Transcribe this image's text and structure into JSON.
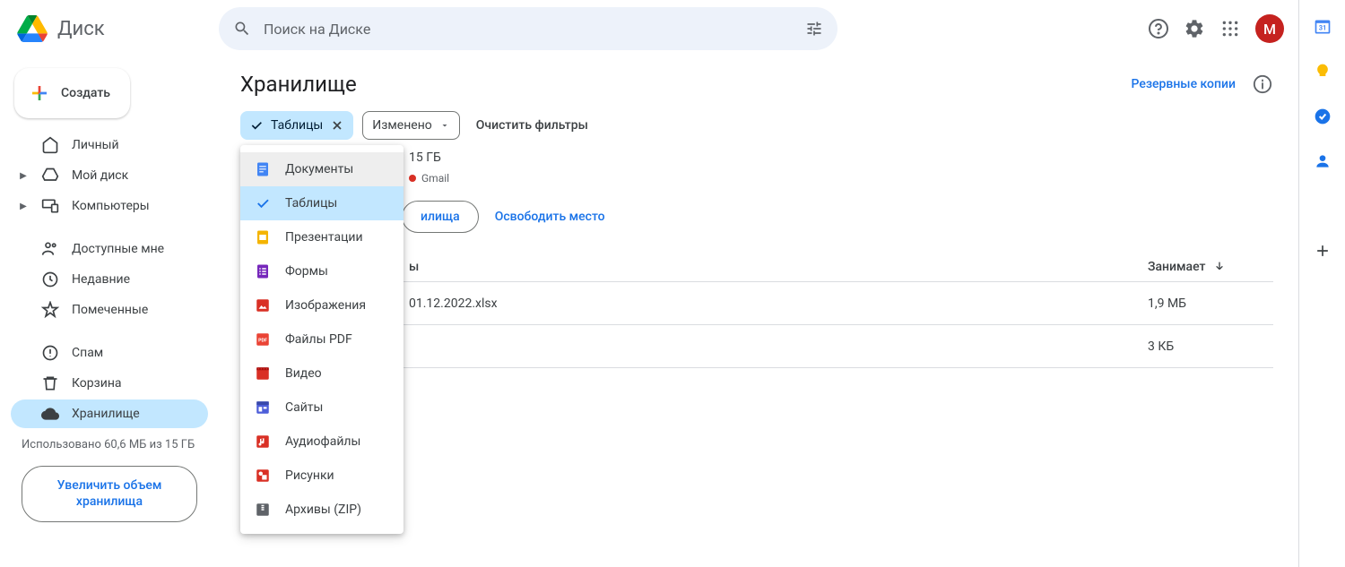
{
  "app": {
    "name": "Диск",
    "search_placeholder": "Поиск на Диске",
    "avatar_initial": "M"
  },
  "sidebar": {
    "create_label": "Создать",
    "items": [
      {
        "label": "Личный",
        "icon": "home"
      },
      {
        "label": "Мой диск",
        "icon": "drive",
        "expandable": true
      },
      {
        "label": "Компьютеры",
        "icon": "devices",
        "expandable": true
      },
      {
        "label": "Доступные мне",
        "icon": "people"
      },
      {
        "label": "Недавние",
        "icon": "clock"
      },
      {
        "label": "Помеченные",
        "icon": "star"
      },
      {
        "label": "Спам",
        "icon": "spam"
      },
      {
        "label": "Корзина",
        "icon": "trash"
      },
      {
        "label": "Хранилище",
        "icon": "cloud",
        "active": true
      }
    ],
    "storage_text": "Использовано 60,6 МБ из 15 ГБ",
    "upgrade_label": "Увеличить объем хранилища"
  },
  "main": {
    "title": "Хранилище",
    "backups_link": "Резервные копии",
    "filters": {
      "active_chip": "Таблицы",
      "modified_chip": "Изменено",
      "clear_label": "Очистить фильтры"
    },
    "type_menu": [
      {
        "label": "Документы",
        "color": "#4285f4"
      },
      {
        "label": "Таблицы",
        "selected": true
      },
      {
        "label": "Презентации",
        "color": "#f4b400"
      },
      {
        "label": "Формы",
        "color": "#7627bb"
      },
      {
        "label": "Изображения",
        "color": "#d93025"
      },
      {
        "label": "Файлы PDF",
        "color": "#ea4335"
      },
      {
        "label": "Видео",
        "color": "#d93025"
      },
      {
        "label": "Сайты",
        "color": "#4d5ed9"
      },
      {
        "label": "Аудиофайлы",
        "color": "#d93025"
      },
      {
        "label": "Рисунки",
        "color": "#d93025"
      },
      {
        "label": "Архивы (ZIP)",
        "color": "#5f6368"
      }
    ],
    "usage_line": "15 ГБ",
    "legend": {
      "label": "Gmail"
    },
    "partial_btn": "илища",
    "free_space": "Освободить место",
    "columns": {
      "name": "ы",
      "size": "Занимает"
    },
    "rows": [
      {
        "name": "01.12.2022.xlsx",
        "size": "1,9 МБ"
      },
      {
        "name": "",
        "size": "3 КБ"
      }
    ]
  }
}
